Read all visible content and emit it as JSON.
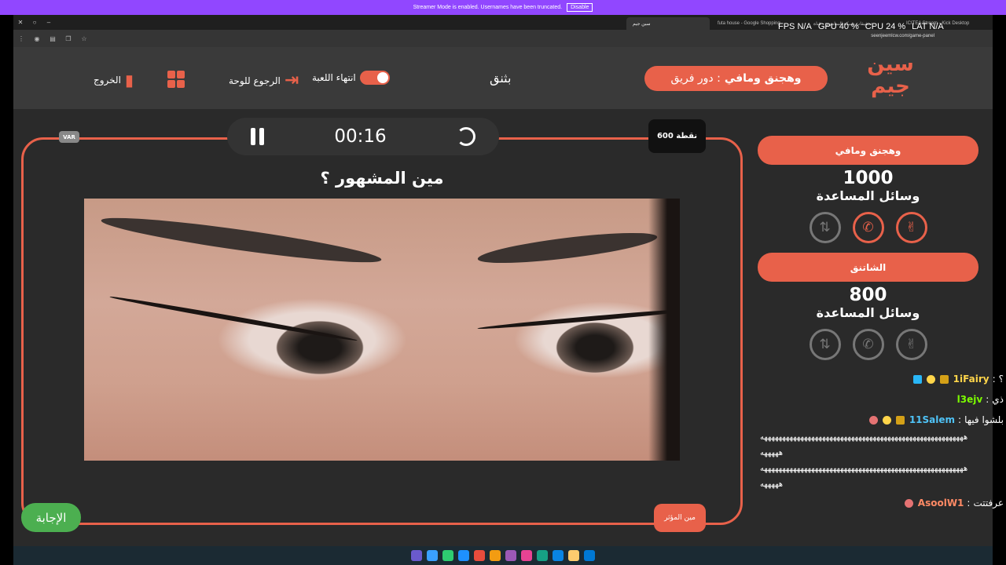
{
  "banner": {
    "text": "Streamer Mode is enabled. Usernames have been truncated.",
    "disable": "Disable"
  },
  "browser": {
    "tabs": [
      "سين جيم",
      "futa house - Google Shopping",
      "تحقيقات شبكة السامري - قناة",
      "ICITEA Stream - Kick Desktop"
    ],
    "url": "seenjeemlcw.com/game-panel"
  },
  "perf": {
    "fps_label": "FPS",
    "fps": "N/A",
    "gpu_label": "GPU",
    "gpu": "40 %",
    "cpu_label": "CPU",
    "cpu": "24 %",
    "lat_label": "LAT",
    "lat": "N/A"
  },
  "header": {
    "logo": "سين جيم",
    "turn_label": "دور فريق :",
    "turn_team": "وهجنق ومافي",
    "category": "بثنق",
    "end_game": "انتهاء اللعبة",
    "back_board": "الرجوع للوحة",
    "exit": "الخروج"
  },
  "game": {
    "timer": "00:16",
    "points": "600 نقطة",
    "var": "VAR",
    "question": "مين المشهور ؟",
    "answer_button": "الإجابة",
    "who_button": "مين المؤثر"
  },
  "teams": [
    {
      "name": "وهجنق ومافي",
      "score": "1000",
      "helps": "وسائل المساعدة"
    },
    {
      "name": "الشاتنق",
      "score": "800",
      "helps": "وسائل المساعدة"
    }
  ],
  "chat": [
    {
      "user": "1iFairy",
      "text": "؟"
    },
    {
      "user": "l3ejv",
      "text": "ذي"
    },
    {
      "user": "11Salem",
      "text": "بلشوا فيها"
    },
    {
      "spam": "ههههههههههههههههههههههههههههههههههههههههههههههههههههههههه"
    },
    {
      "spam": "هههههه"
    },
    {
      "spam": "ههههههههههههههههههههههههههههههههههههههههههههههههههههههههه"
    },
    {
      "spam": "هههههه"
    },
    {
      "user": "AsoolW1",
      "text": "عرفتتت"
    }
  ],
  "colors": {
    "accent": "#e8614a",
    "answer": "#4caf50",
    "banner": "#9147ff"
  }
}
